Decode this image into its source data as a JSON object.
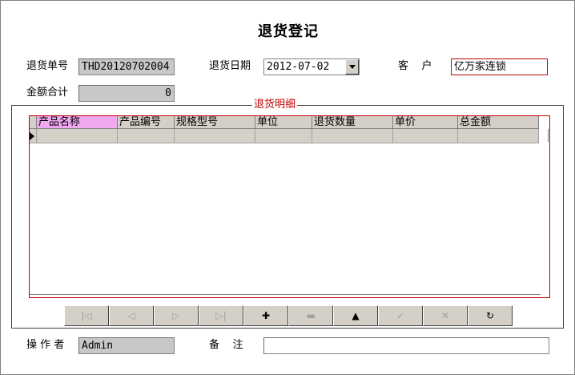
{
  "form": {
    "title": "退货登记",
    "return_no_label": "退货单号",
    "return_no_value": "THD20120702004",
    "return_date_label": "退货日期",
    "return_date_value": "2012-07-02",
    "customer_label": "客    户",
    "customer_value": "亿万家连锁",
    "total_amount_label": "金额合计",
    "total_amount_value": "0",
    "details_group_label": "退货明细",
    "operator_label": "操 作 者",
    "operator_value": "Admin",
    "remark_label": "备    注",
    "remark_value": ""
  },
  "grid": {
    "columns": [
      "产品名称",
      "产品编号",
      "规格型号",
      "单位",
      "退货数量",
      "单价",
      "总金额"
    ],
    "rows": []
  },
  "navigator": {
    "buttons": [
      {
        "name": "first-record-button",
        "icon": "first-icon",
        "glyph": "|◁",
        "enabled": false
      },
      {
        "name": "prior-record-button",
        "icon": "prior-icon",
        "glyph": "◁",
        "enabled": false
      },
      {
        "name": "next-record-button",
        "icon": "next-icon",
        "glyph": "▷",
        "enabled": false
      },
      {
        "name": "last-record-button",
        "icon": "last-icon",
        "glyph": "▷|",
        "enabled": false
      },
      {
        "name": "insert-record-button",
        "icon": "plus-icon",
        "glyph": "✚",
        "enabled": true
      },
      {
        "name": "delete-record-button",
        "icon": "minus-icon",
        "glyph": "▬",
        "enabled": false
      },
      {
        "name": "edit-record-button",
        "icon": "up-arrow-icon",
        "glyph": "▲",
        "enabled": true
      },
      {
        "name": "post-record-button",
        "icon": "check-icon",
        "glyph": "✓",
        "enabled": false
      },
      {
        "name": "cancel-record-button",
        "icon": "cancel-icon",
        "glyph": "✕",
        "enabled": false
      },
      {
        "name": "refresh-record-button",
        "icon": "refresh-icon",
        "glyph": "↻",
        "enabled": true
      }
    ]
  },
  "colors": {
    "accent_red": "#c00000",
    "field_gray": "#c8c8c8",
    "selected_header": "#f0a8f0"
  }
}
